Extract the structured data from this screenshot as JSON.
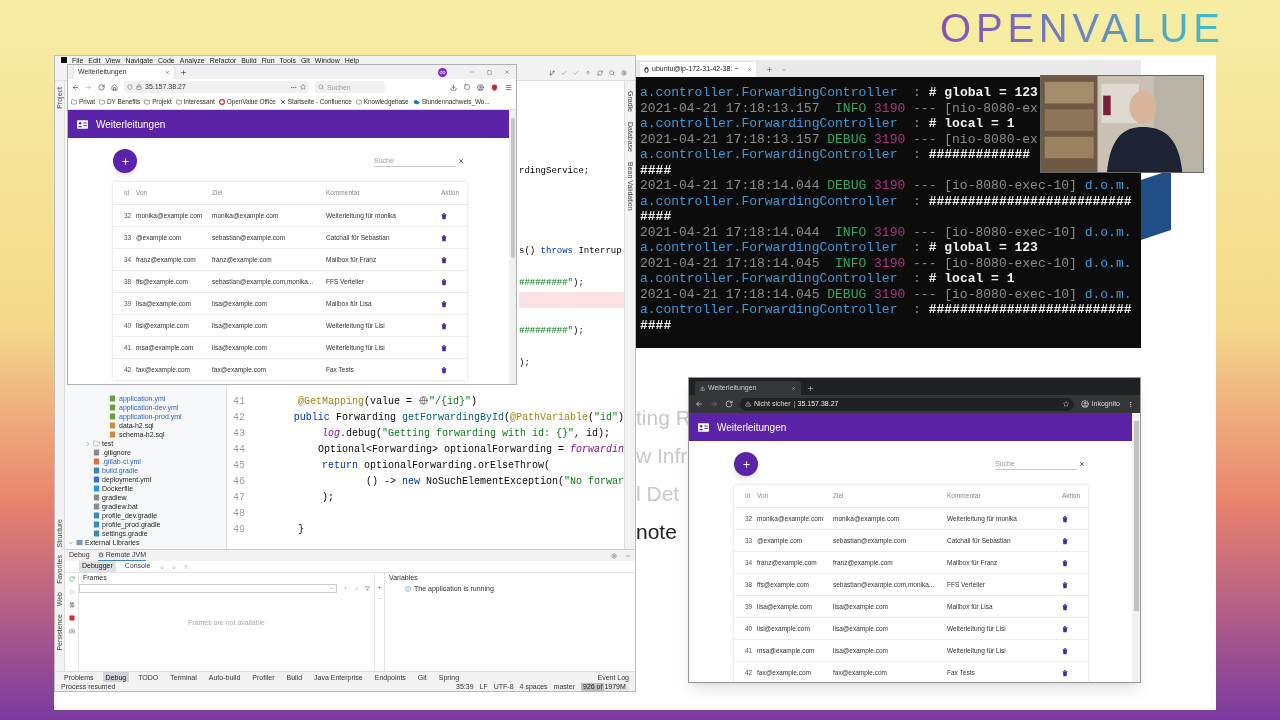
{
  "logo": "OPENVALUE",
  "ide": {
    "menu": [
      "File",
      "Edit",
      "View",
      "Navigate",
      "Code",
      "Analyze",
      "Refactor",
      "Build",
      "Run",
      "Tools",
      "Git",
      "Window",
      "Help"
    ],
    "left_strip_top": [
      "Project"
    ],
    "left_strip_bottom": [
      "Structure",
      "Favorites",
      "Web",
      "Persistence"
    ],
    "right_strip": [
      "Gradle",
      "Database",
      "Bean Validation"
    ],
    "tree": {
      "resource_files": [
        {
          "label": "application.yml",
          "kind": "yaml",
          "modified": true
        },
        {
          "label": "application-dev.yml",
          "kind": "yaml",
          "modified": true
        },
        {
          "label": "application-prod.yml",
          "kind": "yaml",
          "modified": true
        },
        {
          "label": "data-h2.sql",
          "kind": "sql",
          "modified": false
        },
        {
          "label": "schema-h2.sql",
          "kind": "sql",
          "modified": false
        }
      ],
      "project_items": [
        {
          "label": "test",
          "kind": "folder",
          "modified": false,
          "expanded": false
        },
        {
          "label": ".gitignore",
          "kind": "text",
          "modified": false
        },
        {
          "label": ".gitlab-ci.yml",
          "kind": "gitlab",
          "modified": true
        },
        {
          "label": "build.gradle",
          "kind": "gradle",
          "modified": true
        },
        {
          "label": "deployment.yml",
          "kind": "k8s",
          "modified": false
        },
        {
          "label": "Dockerfile",
          "kind": "docker",
          "modified": false
        },
        {
          "label": "gradlew",
          "kind": "text",
          "modified": false
        },
        {
          "label": "gradlew.bat",
          "kind": "text",
          "modified": false
        },
        {
          "label": "profile_dev.gradle",
          "kind": "gradle",
          "modified": false
        },
        {
          "label": "profile_prod.gradle",
          "kind": "gradle",
          "modified": false
        },
        {
          "label": "settings.gradle",
          "kind": "gradle",
          "modified": false
        }
      ],
      "external": {
        "label": "External Libraries",
        "expanded": true
      }
    },
    "editor_fragments": [
      [
        {
          "text": "rdingService;",
          "kind": "plain"
        }
      ],
      [
        {
          "text": "s() ",
          "kind": "plain"
        },
        {
          "text": "throws ",
          "kind": "keyword"
        },
        {
          "text": "Interrup",
          "kind": "plain"
        }
      ],
      [
        {
          "text": "#########\"",
          "kind": "string"
        },
        {
          "text": ");",
          "kind": "plain"
        }
      ],
      [
        {
          "text": "#########\"",
          "kind": "string"
        },
        {
          "text": ");",
          "kind": "plain"
        }
      ],
      [
        {
          "text": ");",
          "kind": "plain"
        }
      ]
    ],
    "code_lines": [
      {
        "number": "41",
        "tokens": [
          {
            "text": "@GetMapping",
            "kind": "annotation"
          },
          {
            "text": "(value = ",
            "kind": "plain"
          },
          {
            "kind": "web-marker"
          },
          {
            "text": "\"/{id}\"",
            "kind": "string"
          },
          {
            "text": ")",
            "kind": "plain"
          }
        ]
      },
      {
        "number": "42",
        "tokens": [
          {
            "text": "public ",
            "kind": "keyword"
          },
          {
            "text": "Forwarding ",
            "kind": "plain"
          },
          {
            "text": "getForwardingById",
            "kind": "method"
          },
          {
            "text": "(",
            "kind": "plain"
          },
          {
            "text": "@PathVariable",
            "kind": "annotation"
          },
          {
            "text": "(",
            "kind": "plain"
          },
          {
            "text": "\"id\"",
            "kind": "string"
          },
          {
            "text": ")",
            "kind": "plain"
          }
        ]
      },
      {
        "number": "43",
        "tokens": [
          {
            "text": "    log",
            "kind": "field"
          },
          {
            "text": ".debug(",
            "kind": "plain"
          },
          {
            "text": "\"Getting forwarding with id: {}\"",
            "kind": "string"
          },
          {
            "text": ", id);",
            "kind": "plain"
          }
        ]
      },
      {
        "number": "44",
        "tokens": [
          {
            "text": "    Optional<Forwarding> optionalForwarding = ",
            "kind": "plain"
          },
          {
            "text": "forwardin",
            "kind": "field"
          }
        ]
      },
      {
        "number": "45",
        "tokens": [
          {
            "text": "    return ",
            "kind": "keyword"
          },
          {
            "text": "optionalForwarding.orElseThrow(",
            "kind": "plain"
          }
        ]
      },
      {
        "number": "46",
        "tokens": [
          {
            "text": "            () -> ",
            "kind": "plain"
          },
          {
            "text": "new ",
            "kind": "keyword"
          },
          {
            "text": "NoSuchElementException(",
            "kind": "plain"
          },
          {
            "text": "\"No forwar",
            "kind": "string"
          }
        ]
      },
      {
        "number": "47",
        "tokens": [
          {
            "text": "    );",
            "kind": "plain"
          }
        ]
      },
      {
        "number": "48"
      },
      {
        "number": "49",
        "tokens": [
          {
            "text": "}",
            "kind": "plain"
          }
        ]
      }
    ],
    "debug": {
      "title": "Debug",
      "session": "Remote JVM",
      "tabs": [
        {
          "label": "Debugger",
          "selected": true
        },
        {
          "label": "Console",
          "selected": false
        }
      ],
      "frames_header": "Frames",
      "frames_empty": "Frames are not available",
      "variables_header": "Variables",
      "status": "The application is running"
    },
    "tool_tabs": [
      {
        "label": "Problems",
        "selected": false
      },
      {
        "label": "Debug",
        "selected": true
      },
      {
        "label": "TODO",
        "selected": false
      },
      {
        "label": "Terminal",
        "selected": false
      },
      {
        "label": "Auto-build",
        "selected": false
      },
      {
        "label": "Profiler",
        "selected": false
      },
      {
        "label": "Build",
        "selected": false
      },
      {
        "label": "Java Enterprise",
        "selected": false
      },
      {
        "label": "Endpoints",
        "selected": false
      },
      {
        "label": "Git",
        "selected": false
      },
      {
        "label": "Spring",
        "selected": false
      }
    ],
    "event_log": "Event Log",
    "status": {
      "message": "Process resumed",
      "items": [
        "35:39",
        "LF",
        "UTF-8",
        "4 spaces",
        "master"
      ],
      "memory": "926 of 1979M",
      "memory_level": {
        "level": 0.47
      }
    }
  },
  "firefox": {
    "tab": "Weiterleitungen",
    "url": "35.157.38.27",
    "search_placeholder": "Suchen",
    "bookmarks": [
      {
        "label": "Privat",
        "kind": "folder"
      },
      {
        "label": "DY Benefits",
        "kind": "folder"
      },
      {
        "label": "Projekt",
        "kind": "folder"
      },
      {
        "label": "Interessant",
        "kind": "folder"
      },
      {
        "label": "OpenValue Office",
        "kind": "office"
      },
      {
        "label": "Startseite - Confluence",
        "kind": "confluence"
      },
      {
        "label": "Knowledgebase",
        "kind": "folder"
      },
      {
        "label": "Stundennachweis_Wo...",
        "kind": "cloud"
      }
    ],
    "app": {
      "title": "Weiterleitungen",
      "search_placeholder": "Suche",
      "columns": [
        "Id",
        "Von",
        "Ziel",
        "Kommentar",
        "Aktion"
      ],
      "rows": [
        {
          "id": "32",
          "from": "monika@example.com",
          "to": "monika@example.com",
          "comment": "Weiterleitung für monika"
        },
        {
          "id": "33",
          "from": "@example.com",
          "to": "sebastian@example.com",
          "comment": "Catchall für Sebastian"
        },
        {
          "id": "34",
          "from": "franz@example.com",
          "to": "franz@example.com",
          "comment": "Mailbox für Franz"
        },
        {
          "id": "38",
          "from": "ffs@example.com",
          "to": "sebastian@example.com,monika...",
          "comment": "FFS Verteiler"
        },
        {
          "id": "39",
          "from": "lisa@example.com",
          "to": "lisa@example.com",
          "comment": "Mailbox für Lisa"
        },
        {
          "id": "40",
          "from": "lisi@example.com",
          "to": "lisa@example.com",
          "comment": "Weiterleitung für Lisi"
        },
        {
          "id": "41",
          "from": "msa@example.com",
          "to": "lisa@example.com",
          "comment": "Weiterleitung für Lisi"
        },
        {
          "id": "42",
          "from": "fax@example.com",
          "to": "fax@example.com",
          "comment": "Fax Tests"
        }
      ]
    }
  },
  "terminal": {
    "tab": "ubuntu@ip-172-31-42-38: ~",
    "lines": [
      [
        {
          "text": "a.controller.ForwardingController",
          "kind": "logger"
        },
        {
          "text": "  : ",
          "kind": "time"
        },
        {
          "text": "# global = 123",
          "kind": "message"
        }
      ],
      [
        {
          "text": "2021-04-21 17:18:13.157",
          "kind": "time"
        },
        {
          "text": "  INFO",
          "kind": "level"
        },
        {
          "text": " 3190",
          "kind": "pid"
        },
        {
          "text": " --- [nio-8080-ex",
          "kind": "time"
        }
      ],
      [
        {
          "text": "a.controller.ForwardingController",
          "kind": "logger"
        },
        {
          "text": "  : ",
          "kind": "time"
        },
        {
          "text": "# local = 1",
          "kind": "message"
        }
      ],
      [
        {
          "text": "2021-04-21 17:18:13.157",
          "kind": "time"
        },
        {
          "text": " DEBUG",
          "kind": "level"
        },
        {
          "text": " 3190",
          "kind": "pid"
        },
        {
          "text": " --- [nio-8080-ex",
          "kind": "time"
        }
      ],
      [
        {
          "text": "a.controller.ForwardingController",
          "kind": "logger"
        },
        {
          "text": "  : ",
          "kind": "time"
        },
        {
          "text": "#############",
          "kind": "message"
        }
      ],
      [
        {
          "text": "####",
          "kind": "message"
        }
      ],
      [
        {
          "text": "2021-04-21 17:18:14.044",
          "kind": "time"
        },
        {
          "text": " DEBUG",
          "kind": "level"
        },
        {
          "text": " 3190",
          "kind": "pid"
        },
        {
          "text": " --- [io-8080-exec-10] ",
          "kind": "time"
        },
        {
          "text": "d.o.m.",
          "kind": "logger"
        }
      ],
      [
        {
          "text": "a.controller.ForwardingController",
          "kind": "logger"
        },
        {
          "text": "  : ",
          "kind": "time"
        },
        {
          "text": "##########################",
          "kind": "message"
        }
      ],
      [
        {
          "text": "####",
          "kind": "message"
        }
      ],
      [
        {
          "text": "2021-04-21 17:18:14.044",
          "kind": "time"
        },
        {
          "text": "  INFO",
          "kind": "level"
        },
        {
          "text": " 3190",
          "kind": "pid"
        },
        {
          "text": " --- [io-8080-exec-10] ",
          "kind": "time"
        },
        {
          "text": "d.o.m.",
          "kind": "logger"
        }
      ],
      [
        {
          "text": "a.controller.ForwardingController",
          "kind": "logger"
        },
        {
          "text": "  : ",
          "kind": "time"
        },
        {
          "text": "# global = 123",
          "kind": "message"
        }
      ],
      [
        {
          "text": "2021-04-21 17:18:14.045",
          "kind": "time"
        },
        {
          "text": "  INFO",
          "kind": "level"
        },
        {
          "text": " 3190",
          "kind": "pid"
        },
        {
          "text": " --- [io-8080-exec-10] ",
          "kind": "time"
        },
        {
          "text": "d.o.m.",
          "kind": "logger"
        }
      ],
      [
        {
          "text": "a.controller.ForwardingController",
          "kind": "logger"
        },
        {
          "text": "  : ",
          "kind": "time"
        },
        {
          "text": "# local = 1",
          "kind": "message"
        }
      ],
      [
        {
          "text": "2021-04-21 17:18:14.045",
          "kind": "time"
        },
        {
          "text": " DEBUG",
          "kind": "level"
        },
        {
          "text": " 3190",
          "kind": "pid"
        },
        {
          "text": " --- [io-8080-exec-10] ",
          "kind": "time"
        },
        {
          "text": "d.o.m.",
          "kind": "logger"
        }
      ],
      [
        {
          "text": "a.controller.ForwardingController",
          "kind": "logger"
        },
        {
          "text": "  : ",
          "kind": "time"
        },
        {
          "text": "##########################",
          "kind": "message"
        }
      ],
      [
        {
          "text": "####",
          "kind": "message"
        }
      ]
    ]
  },
  "slide_fragments": [
    {
      "text": "ting R",
      "dimmed": true
    },
    {
      "text": "w Infr",
      "dimmed": true
    },
    {
      "text": "l Det",
      "dimmed": true
    },
    {
      "text": "note",
      "dimmed": false
    }
  ],
  "chrome": {
    "tab": "Weiterleitungen",
    "security": "Nicht sicher",
    "url": "35.157.38.27",
    "profile": "Inkognito",
    "app": {
      "title": "Weiterleitungen",
      "search_placeholder": "Suche",
      "columns": [
        "Id",
        "Von",
        "Ziel",
        "Kommentar",
        "Aktion"
      ],
      "rows": [
        {
          "id": "32",
          "from": "monika@example.com",
          "to": "monika@example.com",
          "comment": "Weiterleitung für monika"
        },
        {
          "id": "33",
          "from": "@example.com",
          "to": "sebastian@example.com",
          "comment": "Catchall für Sebastian"
        },
        {
          "id": "34",
          "from": "franz@example.com",
          "to": "franz@example.com",
          "comment": "Mailbox für Franz"
        },
        {
          "id": "38",
          "from": "ffs@example.com",
          "to": "sebastian@example.com,monika...",
          "comment": "FFS Verteiler"
        },
        {
          "id": "39",
          "from": "lisa@example.com",
          "to": "lisa@example.com",
          "comment": "Mailbox für Lisa"
        },
        {
          "id": "40",
          "from": "lisi@example.com",
          "to": "lisa@example.com",
          "comment": "Weiterleitung für Lisi"
        },
        {
          "id": "41",
          "from": "msa@example.com",
          "to": "lisa@example.com",
          "comment": "Weiterleitung für Lisi"
        },
        {
          "id": "42",
          "from": "fax@example.com",
          "to": "fax@example.com",
          "comment": "Fax Tests"
        }
      ]
    }
  }
}
